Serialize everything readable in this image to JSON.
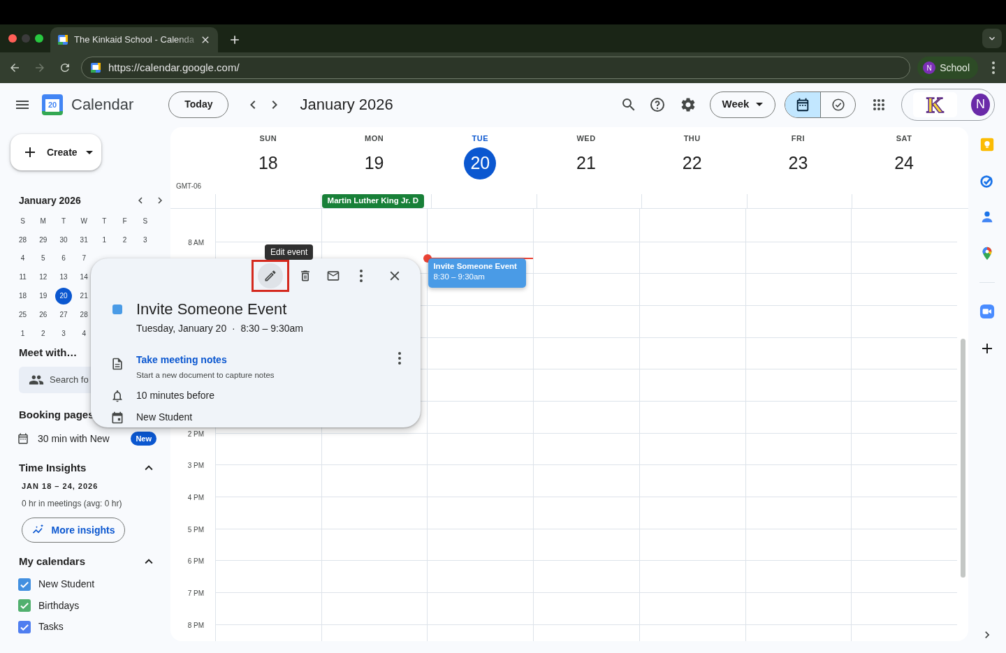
{
  "browser": {
    "tabs": [
      {
        "title": "The Kinkaid School - Calenda",
        "selected": true
      }
    ],
    "url": "https://calendar.google.com/",
    "forward_disabled": true,
    "profile": {
      "initial": "N",
      "label": "School"
    }
  },
  "header": {
    "logo_text": "20",
    "app_name": "Calendar",
    "today_button": "Today",
    "period": "January 2026",
    "view": "Week",
    "view_toggle": [
      {
        "kind": "calendar",
        "selected": true
      },
      {
        "kind": "tasks",
        "selected": false
      }
    ],
    "account": {
      "org_logo": "K",
      "initial": "N"
    }
  },
  "sidebar": {
    "create_button": "Create",
    "mini_calendar": {
      "title": "January 2026",
      "weekdays": [
        "S",
        "M",
        "T",
        "W",
        "T",
        "F",
        "S"
      ],
      "weeks": [
        [
          {
            "d": "28",
            "selected": false
          },
          {
            "d": "29",
            "selected": false
          },
          {
            "d": "30",
            "selected": false
          },
          {
            "d": "31",
            "selected": false
          },
          {
            "d": "1",
            "selected": false
          },
          {
            "d": "2",
            "selected": false
          },
          {
            "d": "3",
            "selected": false
          }
        ],
        [
          {
            "d": "4",
            "selected": false
          },
          {
            "d": "5",
            "selected": false
          },
          {
            "d": "6",
            "selected": false
          },
          {
            "d": "7",
            "selected": false
          }
        ],
        [
          {
            "d": "11",
            "selected": false
          },
          {
            "d": "12",
            "selected": false
          },
          {
            "d": "13",
            "selected": false
          },
          {
            "d": "14",
            "selected": false
          }
        ],
        [
          {
            "d": "18",
            "selected": false
          },
          {
            "d": "19",
            "selected": false
          },
          {
            "d": "20",
            "selected": true
          },
          {
            "d": "21",
            "selected": false
          }
        ],
        [
          {
            "d": "25",
            "selected": false
          },
          {
            "d": "26",
            "selected": false
          },
          {
            "d": "27",
            "selected": false
          },
          {
            "d": "28",
            "selected": false
          }
        ],
        [
          {
            "d": "1",
            "selected": false
          },
          {
            "d": "2",
            "selected": false
          },
          {
            "d": "3",
            "selected": false
          },
          {
            "d": "4",
            "selected": false
          }
        ]
      ]
    },
    "meet_with": {
      "title": "Meet with…",
      "placeholder": "Search fo"
    },
    "booking_pages": {
      "title": "Booking pages",
      "items": [
        {
          "label": "30 min with New",
          "badge": "New"
        }
      ]
    },
    "time_insights": {
      "title": "Time Insights",
      "expanded": true,
      "range": "JAN 18 – 24, 2026",
      "summary": "0 hr in meetings (avg: 0 hr)",
      "button": "More insights"
    },
    "my_calendars": {
      "title": "My calendars",
      "expanded": true,
      "items": [
        {
          "name": "New Student",
          "checked": true,
          "color": "#4290e0"
        },
        {
          "name": "Birthdays",
          "checked": true,
          "color": "#51b06e"
        },
        {
          "name": "Tasks",
          "checked": true,
          "color": "#4f7ef0"
        }
      ]
    }
  },
  "week": {
    "timezone": "GMT-06",
    "days": [
      {
        "weekday": "SUN",
        "date": "18",
        "selected": false
      },
      {
        "weekday": "MON",
        "date": "19",
        "selected": false,
        "all_day": [
          {
            "title": "Martin Luther King Jr. D",
            "color": "#188038"
          }
        ]
      },
      {
        "weekday": "TUE",
        "date": "20",
        "selected": true,
        "events": [
          {
            "title": "Invite Someone Event",
            "time": "8:30 – 9:30am",
            "color": "#4a9be6"
          }
        ]
      },
      {
        "weekday": "WED",
        "date": "21",
        "selected": false
      },
      {
        "weekday": "THU",
        "date": "22",
        "selected": false
      },
      {
        "weekday": "FRI",
        "date": "23",
        "selected": false
      },
      {
        "weekday": "SAT",
        "date": "24",
        "selected": false
      }
    ],
    "hours": [
      "8 AM",
      "2 PM",
      "3 PM",
      "4 PM",
      "5 PM",
      "6 PM",
      "7 PM",
      "8 PM"
    ]
  },
  "event_popup": {
    "tooltip": "Edit event",
    "title": "Invite Someone Event",
    "color": "#4a9be6",
    "when": "Tuesday, January 20  ·  8:30 – 9:30am",
    "notes": {
      "link": "Take meeting notes",
      "hint": "Start a new document to capture notes"
    },
    "reminder": "10 minutes before",
    "calendar": "New Student"
  }
}
